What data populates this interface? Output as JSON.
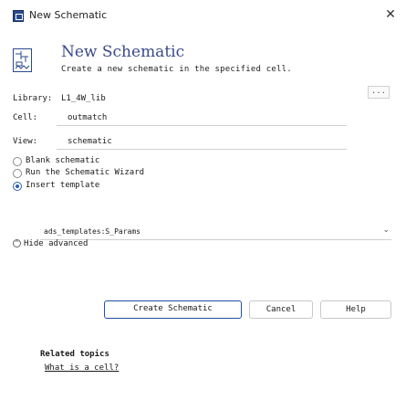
{
  "window": {
    "title": "New Schematic",
    "close_glyph": "✕",
    "app_icon": "schematic-app-icon"
  },
  "header": {
    "title": "New Schematic",
    "subtitle": "Create a new schematic in the specified cell.",
    "icon": "schematic-document-icon"
  },
  "fields": {
    "library_label": "Library:",
    "library_value": "L1_4W_lib",
    "cell_label": "Cell:",
    "cell_value": "outmatch",
    "view_label": "View:",
    "view_value": "schematic",
    "browse_label": "..."
  },
  "options": [
    {
      "label": "Blank schematic",
      "checked": false
    },
    {
      "label": "Run the Schematic Wizard",
      "checked": false
    },
    {
      "label": "Insert template",
      "checked": true
    }
  ],
  "template": {
    "value": "ads_templates:S_Params",
    "chevron": "⌄"
  },
  "advanced": {
    "icon_glyph": "^",
    "label": "Hide advanced"
  },
  "buttons": {
    "create": "Create Schematic",
    "cancel": "Cancel",
    "help": "Help"
  },
  "related": {
    "title": "Related topics",
    "link": "What is a cell?"
  },
  "colors": {
    "accent": "#1f4fa8",
    "title_blue": "#3a4a8a"
  }
}
